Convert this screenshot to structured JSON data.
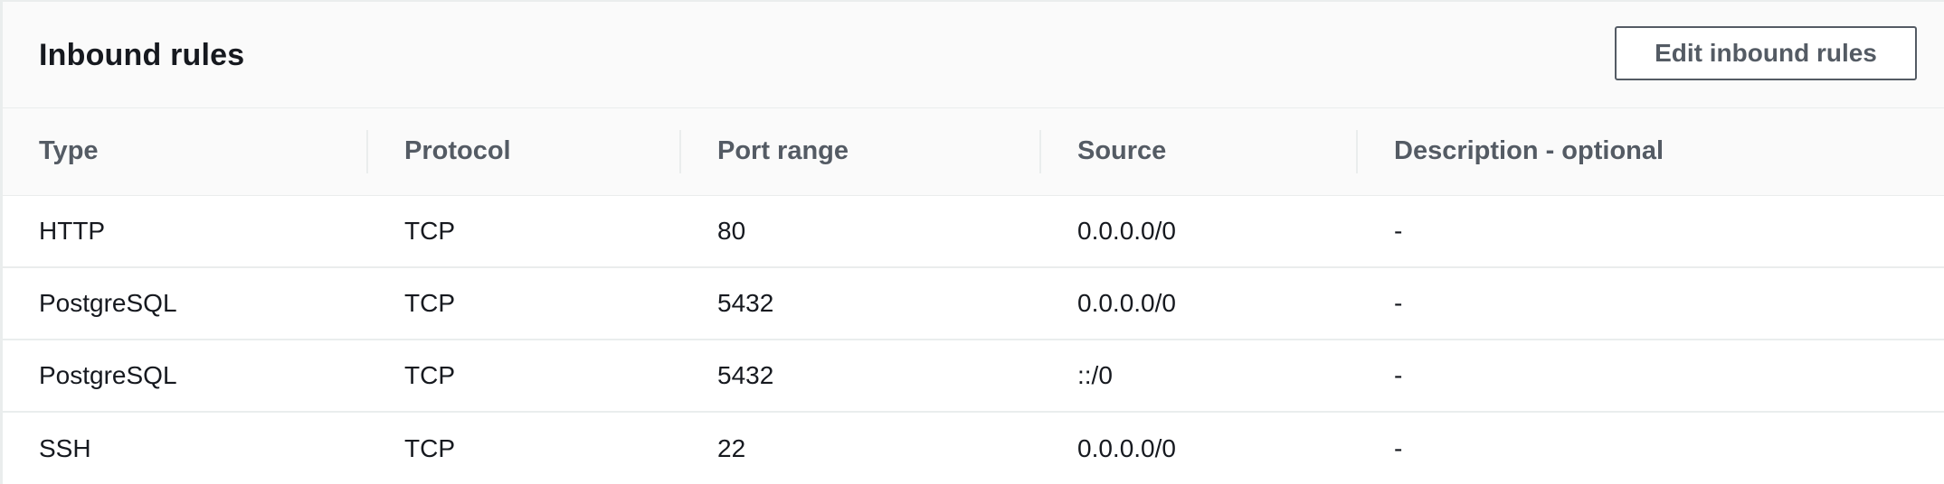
{
  "panel": {
    "title": "Inbound rules",
    "edit_button_label": "Edit inbound rules"
  },
  "table": {
    "columns": [
      "Type",
      "Protocol",
      "Port range",
      "Source",
      "Description - optional"
    ],
    "rows": [
      {
        "type": "HTTP",
        "protocol": "TCP",
        "port_range": "80",
        "source": "0.0.0.0/0",
        "description": "-"
      },
      {
        "type": "PostgreSQL",
        "protocol": "TCP",
        "port_range": "5432",
        "source": "0.0.0.0/0",
        "description": "-"
      },
      {
        "type": "PostgreSQL",
        "protocol": "TCP",
        "port_range": "5432",
        "source": "::/0",
        "description": "-"
      },
      {
        "type": "SSH",
        "protocol": "TCP",
        "port_range": "22",
        "source": "0.0.0.0/0",
        "description": "-"
      }
    ]
  }
}
